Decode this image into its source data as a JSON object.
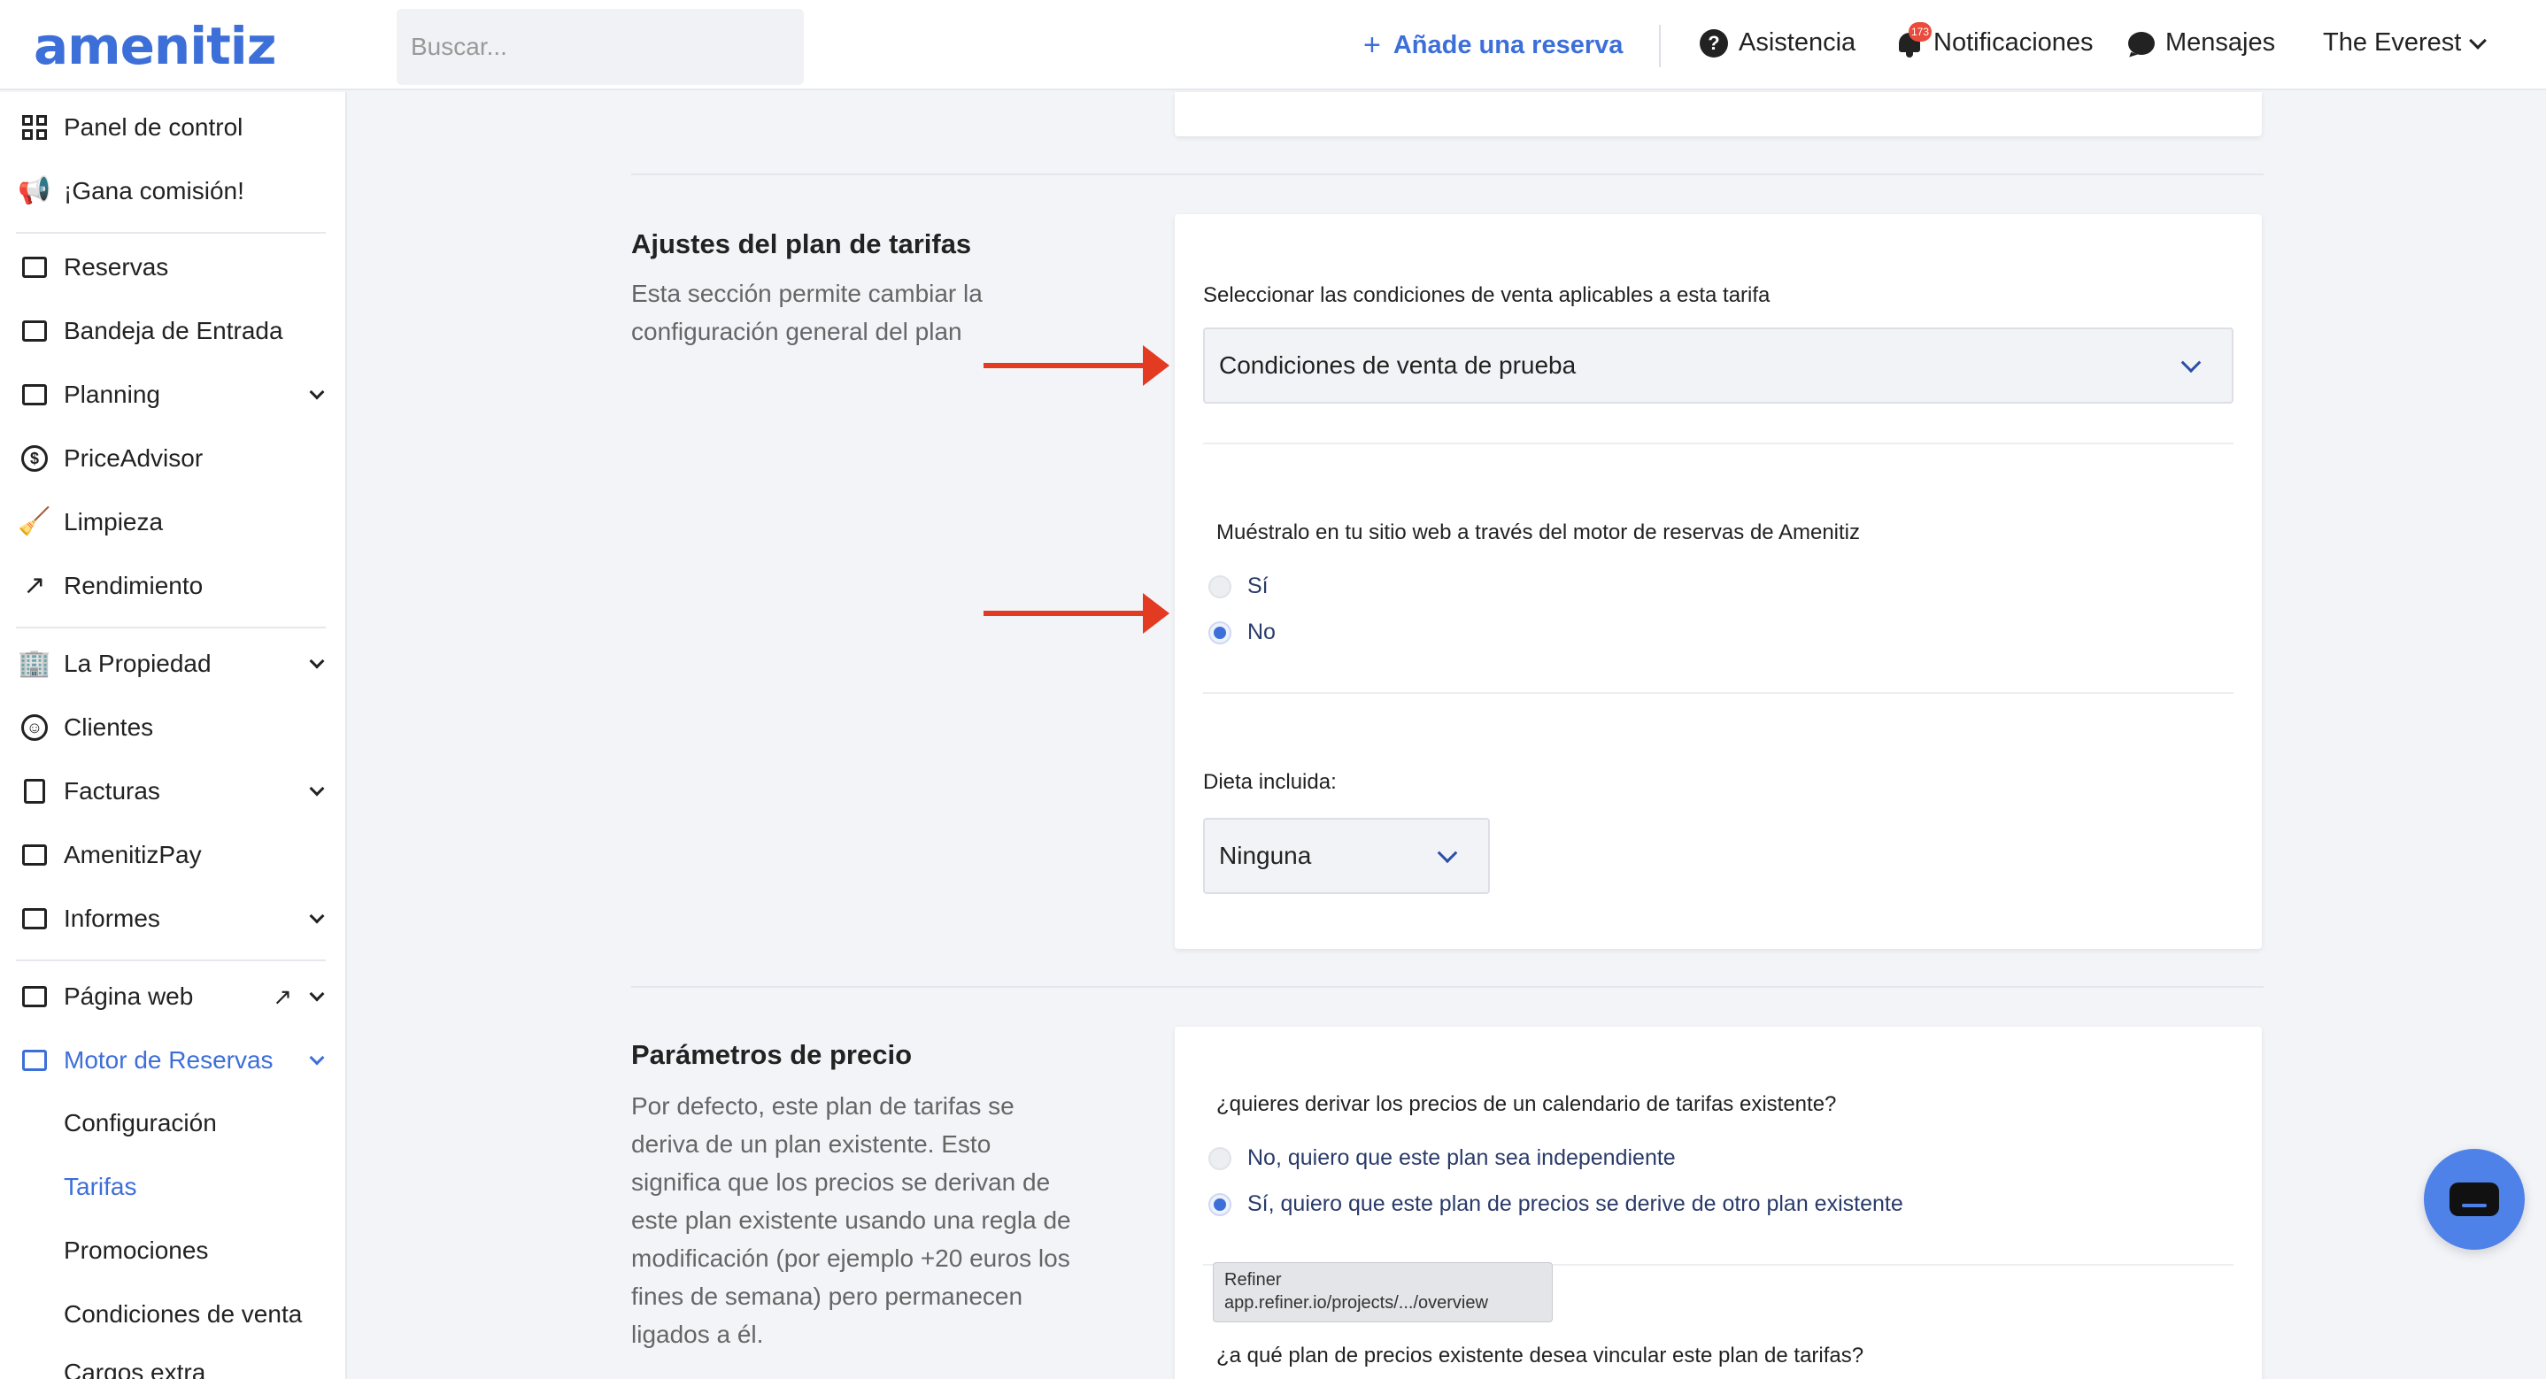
{
  "header": {
    "logo": "amenitiz",
    "search_placeholder": "Buscar...",
    "add_reservation": "Añade una reserva",
    "add_icon": "plus-icon",
    "help": "Asistencia",
    "notifications": "Notificaciones",
    "notifications_badge": "173",
    "messages": "Mensajes",
    "property": "The Everest",
    "accent_color": "#3d6fd9"
  },
  "sidebar": {
    "items": [
      {
        "label": "Panel de control",
        "icon": "dashboard-icon"
      },
      {
        "label": "¡Gana comisión!",
        "icon": "megaphone-icon"
      },
      {
        "label": "Reservas",
        "icon": "suitcase-icon"
      },
      {
        "label": "Bandeja de Entrada",
        "icon": "inbox-icon"
      },
      {
        "label": "Planning",
        "icon": "calendar-icon"
      },
      {
        "label": "PriceAdvisor",
        "icon": "dollar-icon"
      },
      {
        "label": "Limpieza",
        "icon": "broom-icon"
      },
      {
        "label": "Rendimiento",
        "icon": "trend-icon"
      },
      {
        "label": "La Propiedad",
        "icon": "building-icon"
      },
      {
        "label": "Clientes",
        "icon": "users-icon"
      },
      {
        "label": "Facturas",
        "icon": "invoice-icon"
      },
      {
        "label": "AmenitizPay",
        "icon": "card-icon"
      },
      {
        "label": "Informes",
        "icon": "chart-icon"
      },
      {
        "label": "Página web",
        "icon": "browser-icon"
      },
      {
        "label": "Motor de Reservas",
        "icon": "booking-engine-icon"
      }
    ],
    "sub_items": [
      {
        "label": "Configuración"
      },
      {
        "label": "Tarifas"
      },
      {
        "label": "Promociones"
      },
      {
        "label": "Condiciones de venta"
      },
      {
        "label": "Cargos extra"
      }
    ]
  },
  "rate_plan_settings": {
    "title": "Ajustes del plan de tarifas",
    "description": "Esta sección permite cambiar la configuración general del plan",
    "conditions_label": "Seleccionar las condiciones de venta aplicables a esta tarifa",
    "conditions_value": "Condiciones de venta de prueba",
    "show_label": "Muéstralo en tu sitio web a través del motor de reservas de Amenitiz",
    "option_yes": "Sí",
    "option_no": "No",
    "selected_show": "No",
    "diet_label": "Dieta incluida:",
    "diet_value": "Ninguna"
  },
  "price_params": {
    "title": "Parámetros de precio",
    "description": "Por defecto, este plan de tarifas se deriva de un plan existente. Esto significa que los precios se derivan de este plan existente usando una regla de modificación (por ejemplo +20 euros los fines de semana) pero permanecen ligados a él.",
    "derive_label": "¿quieres derivar los precios de un calendario de tarifas existente?",
    "option_independent": "No, quiero que este plan sea independiente",
    "option_derive": "Sí, quiero que este plan de precios se derive de otro plan existente",
    "selected_derive": "Sí, quiero que este plan de precios se derive de otro plan existente",
    "link_label": "¿a qué plan de precios existente desea vincular este plan de tarifas?"
  },
  "tooltip": {
    "title": "Refiner",
    "url": "app.refiner.io/projects/.../overview"
  },
  "annotation_color": "#e33a22"
}
